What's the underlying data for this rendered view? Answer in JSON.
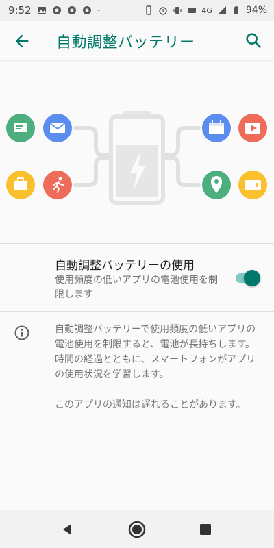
{
  "status_bar": {
    "time": "9:52",
    "network": "4G",
    "battery": "94%"
  },
  "app_bar": {
    "title": "自動調整バッテリー",
    "back_icon": "arrow-back-icon",
    "search_icon": "search-icon"
  },
  "illustration": {
    "left_apps": [
      {
        "icon": "message-icon",
        "color": "#4caf7d"
      },
      {
        "icon": "mail-icon",
        "color": "#5b8def"
      },
      {
        "icon": "briefcase-icon",
        "color": "#fbc02d"
      },
      {
        "icon": "running-icon",
        "color": "#ef6c5a"
      }
    ],
    "right_apps": [
      {
        "icon": "calendar-icon",
        "color": "#5b8def"
      },
      {
        "icon": "video-icon",
        "color": "#ef6c5a"
      },
      {
        "icon": "location-icon",
        "color": "#4caf7d"
      },
      {
        "icon": "ticket-icon",
        "color": "#fbc02d"
      }
    ],
    "battery_icon": "battery-bolt-icon"
  },
  "setting": {
    "title": "自動調整バッテリーの使用",
    "summary": "使用頻度の低いアプリの電池使用を制限します",
    "enabled": true
  },
  "info": {
    "icon": "info-icon",
    "paragraph1": "自動調整バッテリーで使用頻度の低いアプリの電池使用を制限すると、電池が長持ちします。時間の経過とともに、スマートフォンがアプリの使用状況を学習します。",
    "paragraph2": "このアプリの通知は遅れることがあります。"
  },
  "navigation": {
    "back": "nav-back-icon",
    "home": "nav-home-icon",
    "recents": "nav-recents-icon"
  },
  "colors": {
    "accent": "#00796b",
    "switch_track": "#80cbc4"
  }
}
